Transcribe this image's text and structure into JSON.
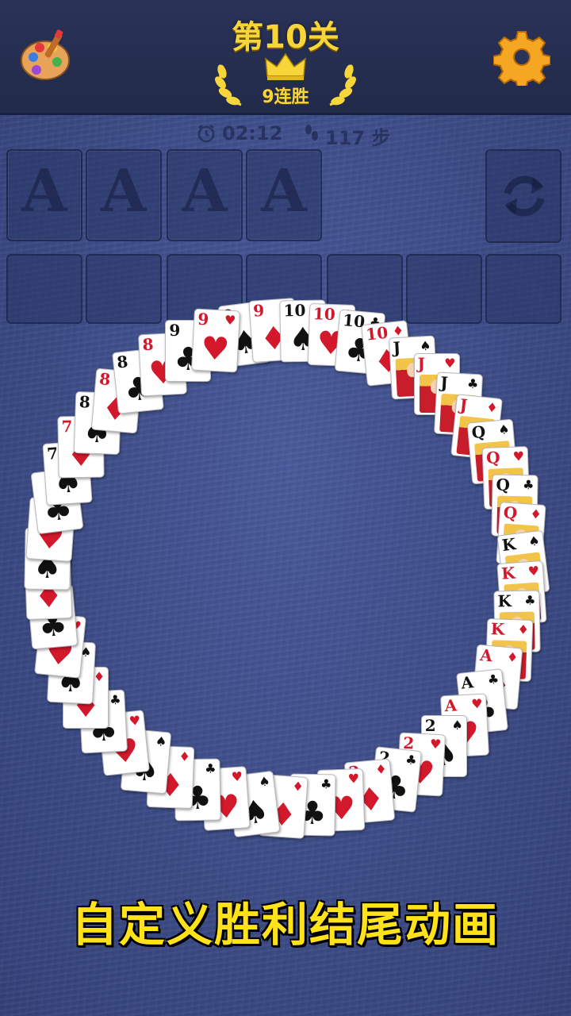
{
  "header": {
    "level_title": "第10关",
    "streak_label": "9连胜",
    "palette_icon": "palette-icon",
    "settings_icon": "gear-icon"
  },
  "stats": {
    "time": "02:12",
    "moves": "117 步",
    "time_icon": "alarm-clock-icon",
    "moves_icon": "footprint-icon"
  },
  "foundations": [
    "A",
    "A",
    "A",
    "A"
  ],
  "free_cell_count": 7,
  "refresh_icon": "refresh-icon",
  "caption": "自定义胜利结尾动画",
  "colors": {
    "title_gold": "#f8d63a",
    "caption_yellow": "#ffe21a",
    "felt_blue": "#3f4f8c",
    "card_red": "#d4182c",
    "card_black": "#111111"
  },
  "ring_cards": [
    {
      "rank": "9",
      "suit": "♠"
    },
    {
      "rank": "9",
      "suit": "♦"
    },
    {
      "rank": "10",
      "suit": "♠"
    },
    {
      "rank": "10",
      "suit": "♥"
    },
    {
      "rank": "10",
      "suit": "♣"
    },
    {
      "rank": "10",
      "suit": "♦"
    },
    {
      "rank": "J",
      "suit": "♠"
    },
    {
      "rank": "J",
      "suit": "♥"
    },
    {
      "rank": "J",
      "suit": "♣"
    },
    {
      "rank": "J",
      "suit": "♦"
    },
    {
      "rank": "Q",
      "suit": "♠"
    },
    {
      "rank": "Q",
      "suit": "♥"
    },
    {
      "rank": "Q",
      "suit": "♣"
    },
    {
      "rank": "Q",
      "suit": "♦"
    },
    {
      "rank": "K",
      "suit": "♠"
    },
    {
      "rank": "K",
      "suit": "♥"
    },
    {
      "rank": "K",
      "suit": "♣"
    },
    {
      "rank": "K",
      "suit": "♦"
    },
    {
      "rank": "A",
      "suit": "♦"
    },
    {
      "rank": "A",
      "suit": "♣"
    },
    {
      "rank": "A",
      "suit": "♥"
    },
    {
      "rank": "2",
      "suit": "♠"
    },
    {
      "rank": "2",
      "suit": "♥"
    },
    {
      "rank": "2",
      "suit": "♣"
    },
    {
      "rank": "2",
      "suit": "♦"
    },
    {
      "rank": "",
      "suit": "♥"
    },
    {
      "rank": "",
      "suit": "♣"
    },
    {
      "rank": "",
      "suit": "♦"
    },
    {
      "rank": "",
      "suit": "♠"
    },
    {
      "rank": "",
      "suit": "♥"
    },
    {
      "rank": "",
      "suit": "♣"
    },
    {
      "rank": "",
      "suit": "♦"
    },
    {
      "rank": "",
      "suit": "♠"
    },
    {
      "rank": "",
      "suit": "♥"
    },
    {
      "rank": "",
      "suit": "♣"
    },
    {
      "rank": "",
      "suit": "♦"
    },
    {
      "rank": "",
      "suit": "♠"
    },
    {
      "rank": "",
      "suit": "♥"
    },
    {
      "rank": "",
      "suit": "♣"
    },
    {
      "rank": "",
      "suit": "♦"
    },
    {
      "rank": "",
      "suit": "♠"
    },
    {
      "rank": "",
      "suit": "♥"
    },
    {
      "rank": "",
      "suit": "♣"
    },
    {
      "rank": "7",
      "suit": "♠"
    },
    {
      "rank": "7",
      "suit": "♦"
    },
    {
      "rank": "8",
      "suit": "♠"
    },
    {
      "rank": "8",
      "suit": "♦"
    },
    {
      "rank": "8",
      "suit": "♣"
    },
    {
      "rank": "8",
      "suit": "♥"
    },
    {
      "rank": "9",
      "suit": "♣"
    },
    {
      "rank": "9",
      "suit": "♥"
    }
  ]
}
